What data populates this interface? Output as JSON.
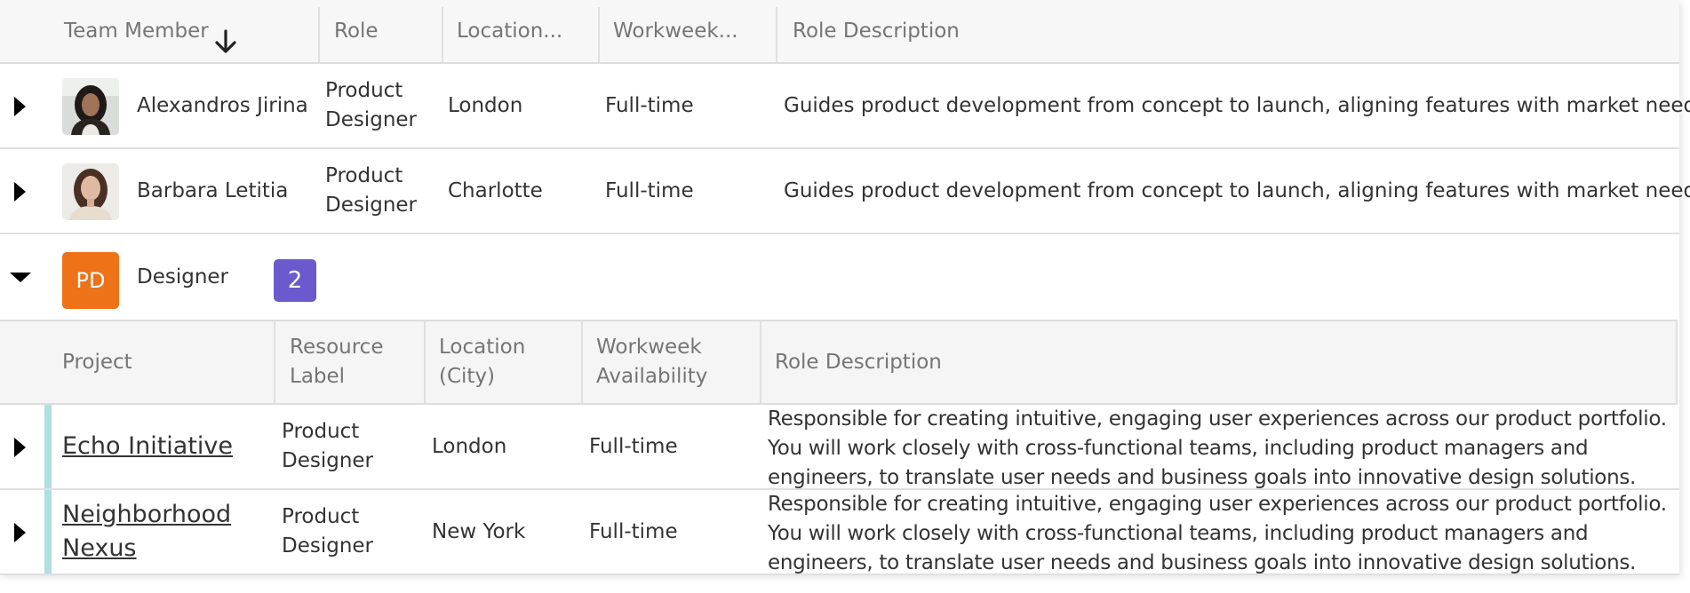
{
  "header": {
    "columns": [
      {
        "label": "Team Member",
        "sort_icon": "arrow-down-icon"
      },
      {
        "label": "Role"
      },
      {
        "label": "Location..."
      },
      {
        "label": "Workweek..."
      },
      {
        "label": "Role Description"
      }
    ]
  },
  "rows": [
    {
      "name": "Alexandros Jirina",
      "role_line1": "Product",
      "role_line2": "Designer",
      "location": "London",
      "workweek": "Full-time",
      "description": "Guides product development from concept to launch, aligning features with market needs."
    },
    {
      "name": "Barbara Letitia",
      "role_line1": "Product",
      "role_line2": "Designer",
      "location": "Charlotte",
      "workweek": "Full-time",
      "description": "Guides product development from concept to launch, aligning features with market needs."
    }
  ],
  "group": {
    "initials": "PD",
    "label": "Designer",
    "count": "2",
    "initials_color": "#ee7218",
    "count_color": "#6a5acd"
  },
  "subgrid": {
    "columns": [
      {
        "label": "Project"
      },
      {
        "label1": "Resource",
        "label2": "Label"
      },
      {
        "label1": "Location",
        "label2": "(City)"
      },
      {
        "label1": "Workweek",
        "label2": "Availability"
      },
      {
        "label": "Role Description"
      }
    ],
    "rows": [
      {
        "project": "Echo Initiative",
        "resource_line1": "Product",
        "resource_line2": "Designer",
        "location": "London",
        "workweek": "Full-time",
        "desc_line1": "Responsible for creating intuitive, engaging user experiences across our product portfolio.",
        "desc_line2": "You will work closely with cross-functional teams, including product managers and",
        "desc_line3": "engineers, to translate user needs and business goals into innovative design solutions."
      },
      {
        "project_line1": "Neighborhood",
        "project_line2": "Nexus",
        "resource_line1": "Product",
        "resource_line2": "Designer",
        "location": "New York",
        "workweek": "Full-time",
        "desc_line1": "Responsible for creating intuitive, engaging user experiences across our product portfolio.",
        "desc_line2": "You will work closely with cross-functional teams, including product managers and",
        "desc_line3": "engineers, to translate user needs and business goals into innovative design solutions."
      }
    ]
  }
}
